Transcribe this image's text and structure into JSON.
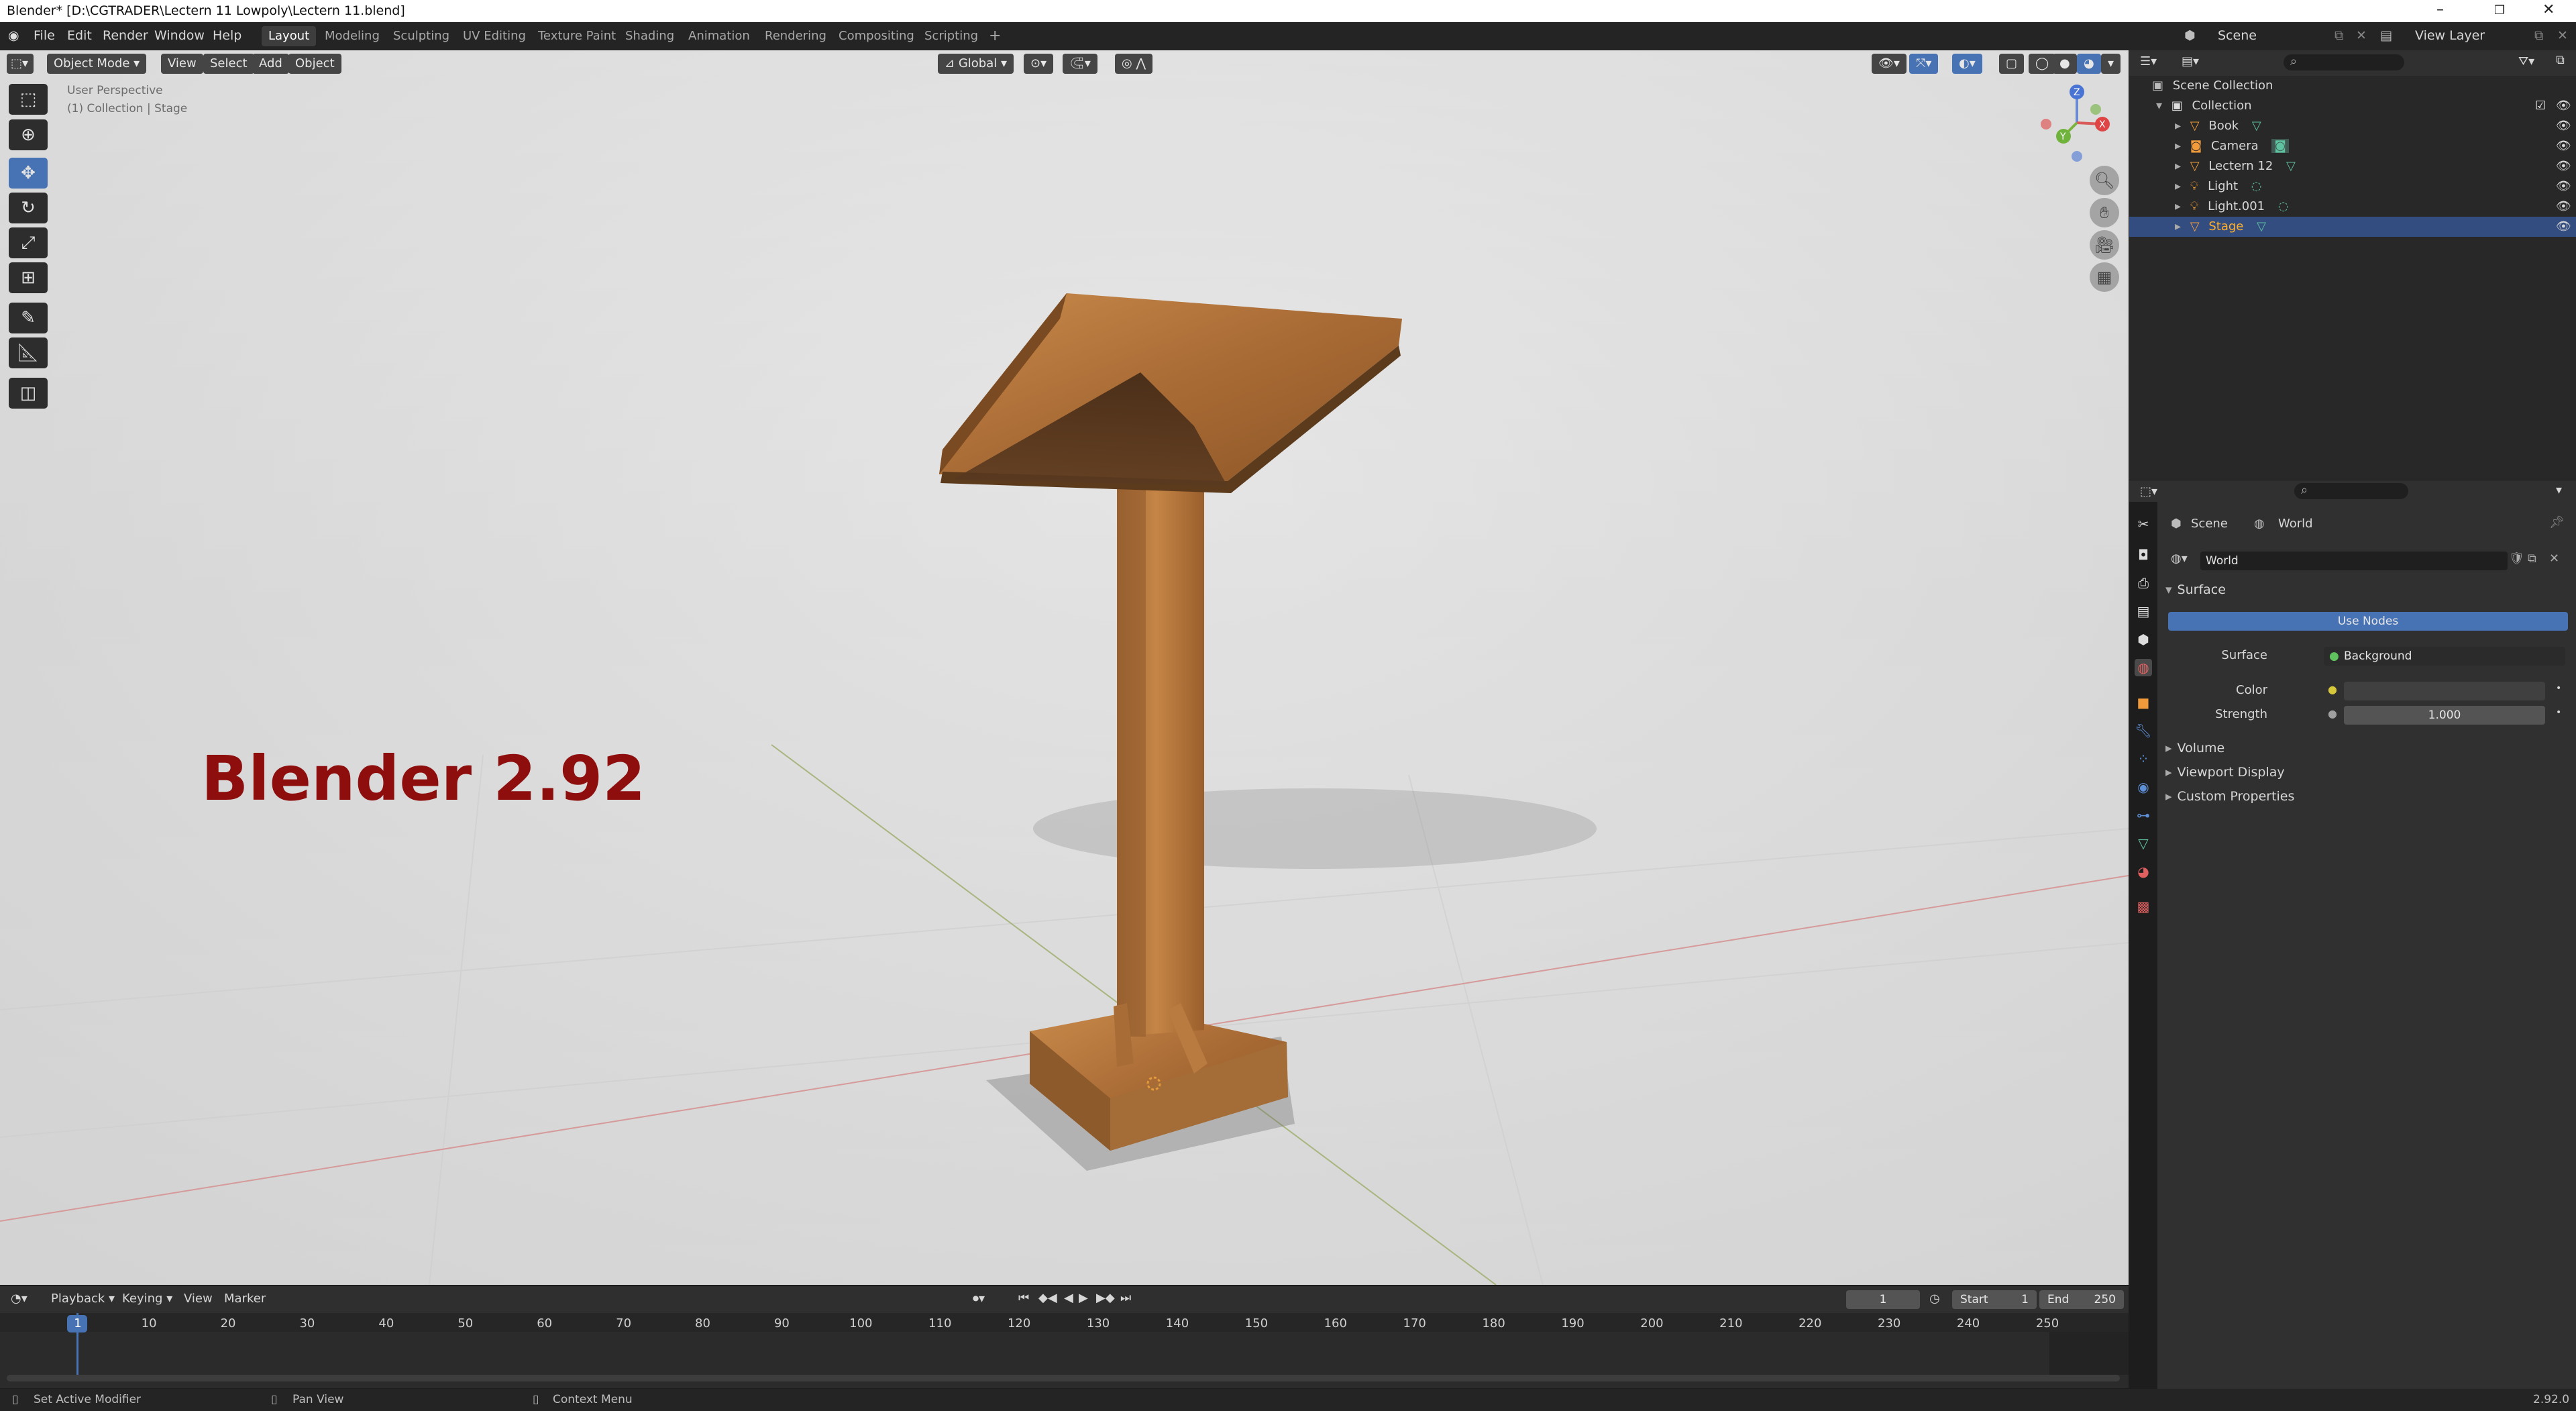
{
  "window": {
    "title": "Blender* [D:\\CGTRADER\\Lectern 11 Lowpoly\\Lectern 11.blend]"
  },
  "menus": [
    "File",
    "Edit",
    "Render",
    "Window",
    "Help"
  ],
  "workspaces": [
    "Layout",
    "Modeling",
    "Sculpting",
    "UV Editing",
    "Texture Paint",
    "Shading",
    "Animation",
    "Rendering",
    "Compositing",
    "Scripting"
  ],
  "active_workspace": "Layout",
  "scene_name": "Scene",
  "view_layer": "View Layer",
  "viewport": {
    "mode": "Object Mode",
    "header_menus": [
      "View",
      "Select",
      "Add",
      "Object"
    ],
    "transform_orientation": "Global",
    "perspective_label": "User Perspective",
    "context_label": "(1) Collection | Stage",
    "watermark": "Blender 2.92"
  },
  "outliner": {
    "root": "Scene Collection",
    "collection": "Collection",
    "items": [
      {
        "name": "Book",
        "selected": false
      },
      {
        "name": "Camera",
        "selected": false
      },
      {
        "name": "Lectern 12",
        "selected": false
      },
      {
        "name": "Light",
        "selected": false
      },
      {
        "name": "Light.001",
        "selected": false
      },
      {
        "name": "Stage",
        "selected": true
      }
    ]
  },
  "properties": {
    "breadcrumb_scene": "Scene",
    "breadcrumb_world": "World",
    "world_name": "World",
    "surface_panel": "Surface",
    "use_nodes": "Use Nodes",
    "surface_label": "Surface",
    "surface_value": "Background",
    "color_label": "Color",
    "strength_label": "Strength",
    "strength_value": "1.000",
    "collapsed_panels": [
      "Volume",
      "Viewport Display",
      "Custom Properties"
    ]
  },
  "timeline": {
    "menus": [
      "Playback",
      "Keying",
      "View",
      "Marker"
    ],
    "current_frame": "1",
    "start_label": "Start",
    "start": "1",
    "end_label": "End",
    "end": "250",
    "ruler": [
      "1",
      "10",
      "20",
      "30",
      "40",
      "50",
      "60",
      "70",
      "80",
      "90",
      "100",
      "110",
      "120",
      "130",
      "140",
      "150",
      "160",
      "170",
      "180",
      "190",
      "200",
      "210",
      "220",
      "230",
      "240",
      "250"
    ]
  },
  "statusbar": {
    "left": "Set Active Modifier",
    "middle": "Pan View",
    "right": "Context Menu",
    "version": "2.92.0"
  },
  "colors": {
    "selection": "#334d80",
    "accent_blue": "#4772b3",
    "selected_text": "#ffaf29",
    "watermark": "#8e0e0e",
    "wood": "#b5773d"
  }
}
